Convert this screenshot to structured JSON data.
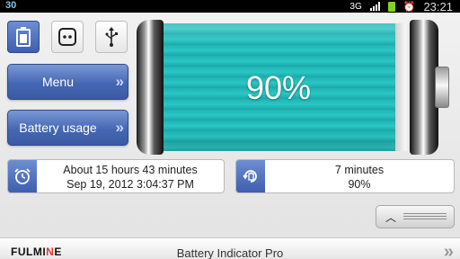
{
  "status_bar": {
    "left_text": "30",
    "network": "3G",
    "clock": "23:21",
    "battery_level": 0.9
  },
  "nav": {
    "menu_label": "Menu",
    "usage_label": "Battery usage"
  },
  "battery": {
    "percent_text": "90%",
    "level": 0.9
  },
  "remaining_card": {
    "line1": "About 15 hours 43 minutes",
    "line2": "Sep 19, 2012 3:04:37 PM"
  },
  "charge_card": {
    "line1": "7 minutes",
    "line2": "90%"
  },
  "footer": {
    "brand_prefix": "FULMI",
    "brand_accent": "N",
    "brand_suffix": "E",
    "title": "Battery Indicator Pro"
  },
  "colors": {
    "accent_blue": "#4567b3",
    "battery_teal": "#2bc7c4",
    "brand_red": "#e03a2e"
  }
}
